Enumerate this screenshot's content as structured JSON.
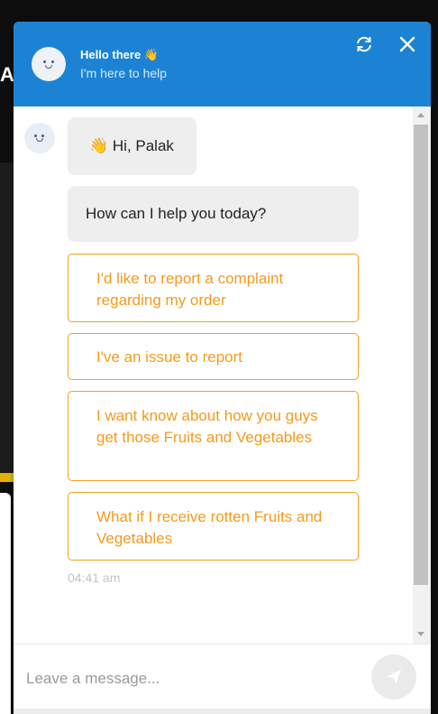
{
  "background": {
    "letter": "A"
  },
  "header": {
    "title": "Hello there 👋",
    "subtitle": "I'm here to help",
    "refresh_icon": "refresh-icon",
    "close_icon": "close-icon",
    "color": "#1c83d4"
  },
  "chat": {
    "greeting": "👋 Hi, Palak",
    "question": "How can I help you today?",
    "options": [
      "I'd like to report a complaint regarding my order",
      "I've an issue to report",
      "I want know about how you guys get those Fruits and Vegetables",
      "What if I receive rotten Fruits and Vegetables"
    ],
    "timestamp": "04:41 am",
    "option_color": "#f39a1c"
  },
  "composer": {
    "placeholder": "Leave a message...",
    "send_icon": "send-icon"
  }
}
